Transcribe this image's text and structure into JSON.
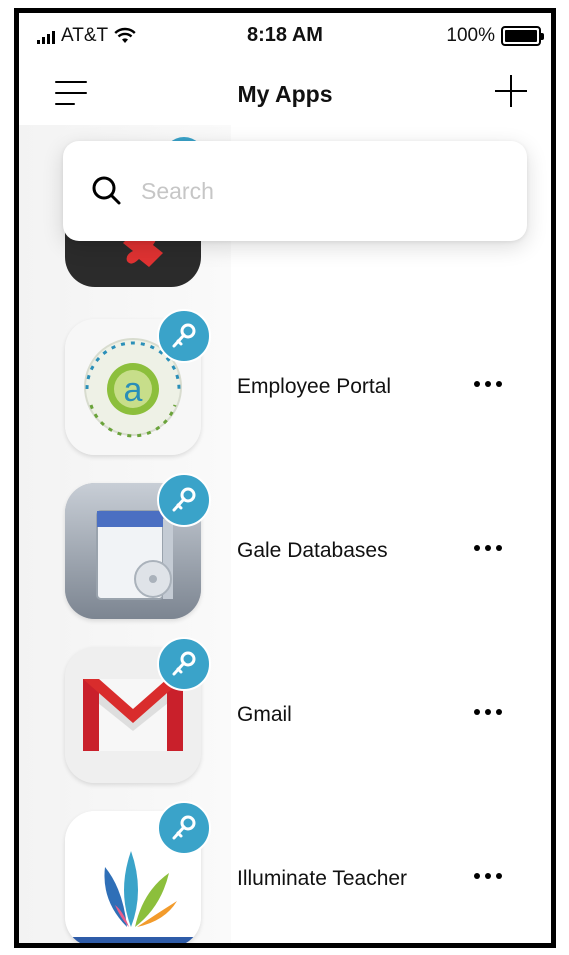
{
  "status_bar": {
    "carrier": "AT&T",
    "time": "8:18 AM",
    "battery_percent": "100%",
    "battery_level": 1.0,
    "icons": [
      "signal-bars-icon",
      "wifi-icon",
      "battery-icon"
    ]
  },
  "nav": {
    "title": "My Apps",
    "menu_icon": "hamburger-menu-icon",
    "add_icon": "plus-icon"
  },
  "search": {
    "placeholder": "Search",
    "value": "",
    "icon": "search-icon"
  },
  "apps": [
    {
      "name": "Employee Portal",
      "icon": "employee-portal-logo",
      "badge": "key-icon"
    },
    {
      "name": "Gale Databases",
      "icon": "gale-databases-logo",
      "badge": "key-icon"
    },
    {
      "name": "Gmail",
      "icon": "gmail-logo",
      "badge": "key-icon"
    },
    {
      "name": "Illuminate Teacher",
      "icon": "illuminate-teacher-logo",
      "badge": "key-icon"
    }
  ],
  "colors": {
    "key_badge": "#3aa3c9",
    "search_placeholder": "#c6c6c6",
    "gmail_red": "#c9202b"
  }
}
